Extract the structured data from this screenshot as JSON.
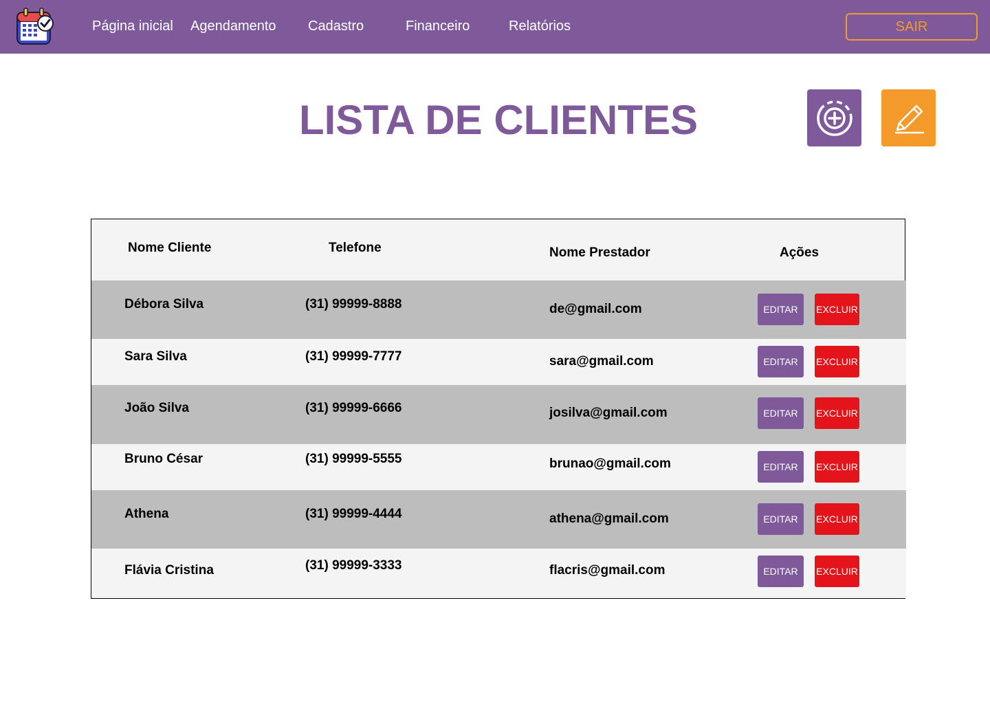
{
  "nav": {
    "items": [
      "Página inicial",
      "Agendamento",
      "Cadastro",
      "Financeiro",
      "Relatórios"
    ],
    "logout": "SAIR",
    "logo_icon": "calendar-check-icon"
  },
  "page": {
    "title": "LISTA DE CLIENTES",
    "add_icon": "add-circle-icon",
    "edit_icon": "pencil-icon"
  },
  "table": {
    "headers": [
      "Nome Cliente",
      "Telefone",
      "Nome Prestador",
      "Ações"
    ],
    "rows": [
      {
        "nome": "Débora Silva",
        "telefone": "(31) 99999-8888",
        "email": "de@gmail.com"
      },
      {
        "nome": "Sara Silva",
        "telefone": "(31) 99999-7777",
        "email": "sara@gmail.com"
      },
      {
        "nome": "João Silva",
        "telefone": "(31) 99999-6666",
        "email": "josilva@gmail.com"
      },
      {
        "nome": "Bruno César",
        "telefone": "(31) 99999-5555",
        "email": "brunao@gmail.com"
      },
      {
        "nome": "Athena",
        "telefone": "(31) 99999-4444",
        "email": "athena@gmail.com"
      },
      {
        "nome": "Flávia Cristina",
        "telefone": "(31) 99999-3333",
        "email": "flacris@gmail.com"
      }
    ],
    "edit_label": "EDITAR",
    "delete_label": "EXCLUIR"
  },
  "colors": {
    "primary": "#7f5a9b",
    "accent": "#f49a2a",
    "danger": "#e3151b",
    "row_dark": "#bdbdbd",
    "row_light": "#f4f4f4"
  }
}
